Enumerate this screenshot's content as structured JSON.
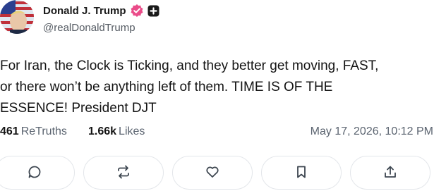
{
  "author": {
    "display_name": "Donald J. Trump",
    "handle": "@realDonaldTrump",
    "verified_icon": "verified-badge-icon",
    "platform_icon": "truth-social-icon",
    "badge_color": "#ea4c89"
  },
  "post": {
    "text": "For Iran, the Clock is Ticking, and they better get moving, FAST,\nor there won’t be anything left of them. TIME IS OF THE\nESSENCE! President DJT"
  },
  "stats": {
    "retruths_count": "461",
    "retruths_label": "ReTruths",
    "likes_count": "1.66k",
    "likes_label": "Likes",
    "timestamp": "May 17, 2026, 10:12 PM"
  },
  "actions": [
    {
      "icon": "reply-icon"
    },
    {
      "icon": "retruth-icon"
    },
    {
      "icon": "like-icon"
    },
    {
      "icon": "bookmark-icon"
    },
    {
      "icon": "share-icon"
    }
  ]
}
